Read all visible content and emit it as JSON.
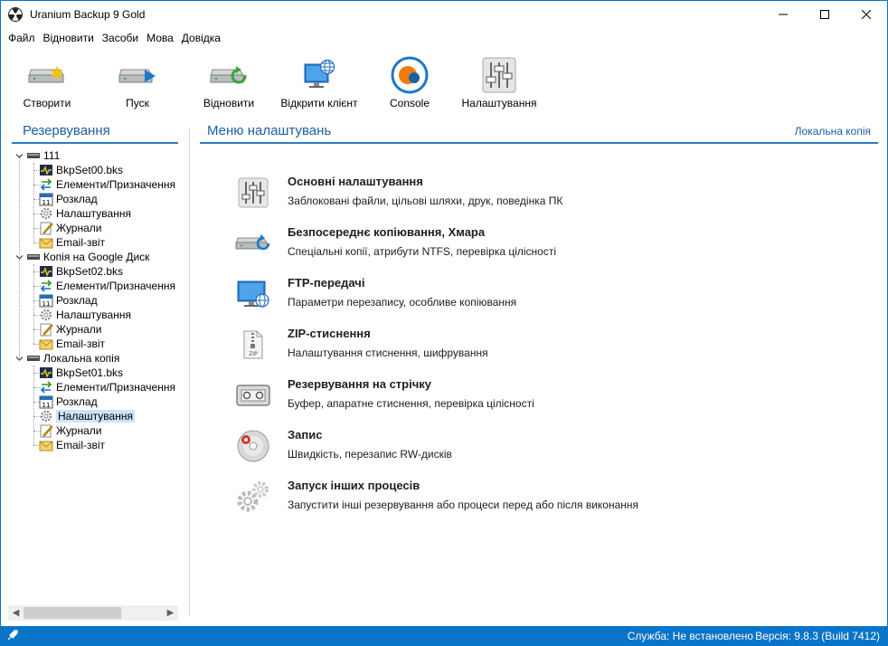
{
  "window": {
    "title": "Uranium Backup 9 Gold"
  },
  "menu": [
    "Файл",
    "Відновити",
    "Засоби",
    "Мова",
    "Довідка"
  ],
  "toolbar": [
    {
      "label": "Створити",
      "icon": "drive-new-icon"
    },
    {
      "label": "Пуск",
      "icon": "drive-run-icon"
    },
    {
      "label": "Відновити",
      "icon": "drive-restore-icon"
    },
    {
      "label": "Відкрити клієнт",
      "icon": "monitor-globe-icon"
    },
    {
      "label": "Console",
      "icon": "console-icon"
    },
    {
      "label": "Налаштування",
      "icon": "sliders-icon"
    }
  ],
  "left_panel": {
    "title": "Резервування"
  },
  "tree": [
    {
      "name": "111",
      "children": [
        "BkpSet00.bks",
        "Елементи/Призначення",
        "Розклад",
        "Налаштування",
        "Журнали",
        "Email-звіт"
      ]
    },
    {
      "name": "Копія на Google Диск",
      "children": [
        "BkpSet02.bks",
        "Елементи/Призначення",
        "Розклад",
        "Налаштування",
        "Журнали",
        "Email-звіт"
      ]
    },
    {
      "name": "Локальна копія",
      "children": [
        "BkpSet01.bks",
        "Елементи/Призначення",
        "Розклад",
        "Налаштування",
        "Журнали",
        "Email-звіт"
      ]
    }
  ],
  "right_panel": {
    "title": "Меню налаштувань",
    "context_link": "Локальна копія",
    "settings": [
      {
        "title": "Основні налаштування",
        "desc": "Заблоковані файли, цільові шляхи, друк, поведінка ПК",
        "icon": "sliders-icon"
      },
      {
        "title": "Безпосереднє копіювання, Хмара",
        "desc": "Спеціальні копії, атрибути NTFS, перевірка цілісності",
        "icon": "drive-sync-icon"
      },
      {
        "title": "FTP-передачі",
        "desc": "Параметри перезапису, особливе копіювання",
        "icon": "monitor-globe-icon"
      },
      {
        "title": "ZIP-стиснення",
        "desc": "Налаштування стиснення, шифрування",
        "icon": "zip-file-icon"
      },
      {
        "title": "Резервування на стрічку",
        "desc": "Буфер, апаратне стиснення, перевірка цілісності",
        "icon": "tape-icon"
      },
      {
        "title": "Запис",
        "desc": "Швидкість, перезапис RW-дисків",
        "icon": "disc-icon"
      },
      {
        "title": "Запуск інших процесів",
        "desc": "Запустити інші резервування або процеси перед або після виконання",
        "icon": "gears-icon"
      }
    ]
  },
  "statusbar": {
    "service": "Служба: Не встановлено",
    "version": "Версія: 9.8.3 (Build 7412)"
  },
  "colors": {
    "accent": "#0a74c8",
    "header_text": "#1f5fa0",
    "selection": "#cce4f7"
  }
}
